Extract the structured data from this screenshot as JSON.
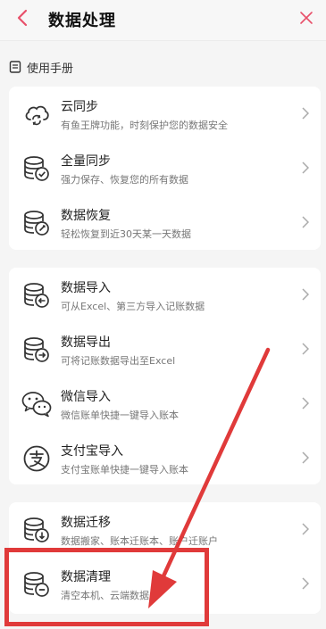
{
  "header": {
    "title": "数据处理",
    "back_icon": "chevron-left-icon",
    "close_icon": "close-icon",
    "accent": "#e8506a"
  },
  "manual": {
    "label": "使用手册",
    "icon": "document-icon"
  },
  "groups": [
    {
      "items": [
        {
          "title": "云同步",
          "subtitle": "有鱼王牌功能，时刻保护您的数据安全",
          "icon": "cloud-sync-icon"
        },
        {
          "title": "全量同步",
          "subtitle": "强力保存、恢复您的所有数据",
          "icon": "database-check-icon"
        },
        {
          "title": "数据恢复",
          "subtitle": "轻松恢复到近30天某一天数据",
          "icon": "database-restore-icon"
        }
      ]
    },
    {
      "items": [
        {
          "title": "数据导入",
          "subtitle": "可从Excel、第三方导入记账数据",
          "icon": "database-import-icon"
        },
        {
          "title": "数据导出",
          "subtitle": "可将记账数据导出至Excel",
          "icon": "database-export-icon"
        },
        {
          "title": "微信导入",
          "subtitle": "微信账单快捷一键导入账本",
          "icon": "wechat-icon"
        },
        {
          "title": "支付宝导入",
          "subtitle": "支付宝账单快捷一键导入账本",
          "icon": "alipay-icon"
        }
      ]
    },
    {
      "items": [
        {
          "title": "数据迁移",
          "subtitle": "数据搬家、账本迁账本、账户迁账户",
          "icon": "database-migrate-icon"
        },
        {
          "title": "数据清理",
          "subtitle": "清空本机、云端数据",
          "icon": "database-clear-icon"
        }
      ]
    }
  ],
  "annotation": {
    "color": "#e03a3a"
  }
}
